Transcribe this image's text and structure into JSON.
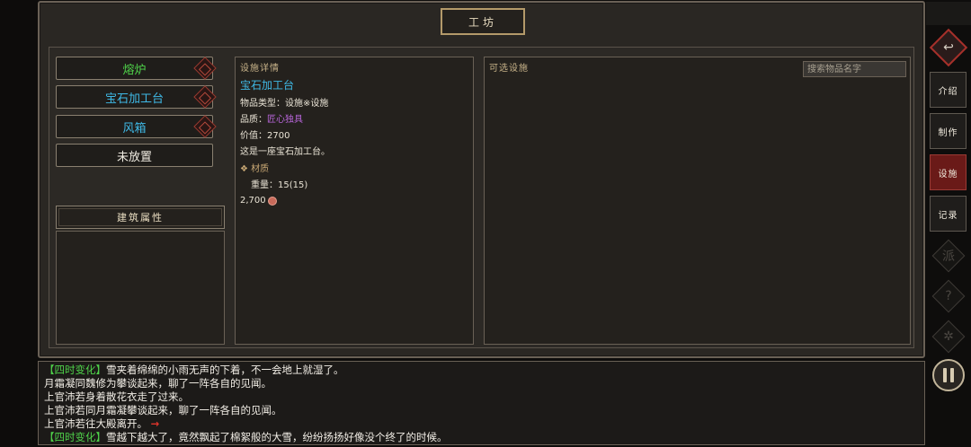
{
  "window": {
    "title": "工坊"
  },
  "facilities": [
    {
      "label": "熔炉",
      "color": "#4fd34a"
    },
    {
      "label": "宝石加工台",
      "color": "#3fb9e6"
    },
    {
      "label": "风箱",
      "color": "#3fb9e6"
    },
    {
      "label": "未放置",
      "color": "#f0ece2"
    }
  ],
  "attributes": {
    "title": "建筑属性"
  },
  "detail": {
    "label": "设施详情",
    "name": "宝石加工台",
    "type": "物品类型：设施※设施",
    "quality_prefix": "品质：",
    "quality": "匠心独具",
    "value": "价值：2700",
    "desc": "这是一座宝石加工台。",
    "material_head": "❖ 材质",
    "weight": "重量：15(15)",
    "price": "2,700"
  },
  "available": {
    "label": "可选设施",
    "search_placeholder": "搜索物品名字"
  },
  "nav": {
    "back_icon": "↩",
    "tabs": [
      {
        "label": "介绍",
        "active": false
      },
      {
        "label": "制作",
        "active": false
      },
      {
        "label": "设施",
        "active": true
      },
      {
        "label": "记录",
        "active": false
      }
    ],
    "ghost_icons": [
      "派",
      "?",
      "✲"
    ]
  },
  "log": [
    {
      "tag": "【四时变化】",
      "text": "雪夹着绵绵的小雨无声的下着，不一会地上就湿了。"
    },
    {
      "tag": "",
      "text": "月霜凝同魏修为攀谈起来，聊了一阵各自的见闻。"
    },
    {
      "tag": "",
      "text": "上官沛若身着散花衣走了过来。"
    },
    {
      "tag": "",
      "text": "上官沛若同月霜凝攀谈起来，聊了一阵各自的见闻。"
    },
    {
      "tag": "",
      "text": "上官沛若往大殿离开。",
      "arrow": "→"
    },
    {
      "tag": "【四时变化】",
      "text": "雪越下越大了，竟然飘起了棉絮般的大雪，纷纷扬扬好像没个终了的时候。"
    }
  ]
}
